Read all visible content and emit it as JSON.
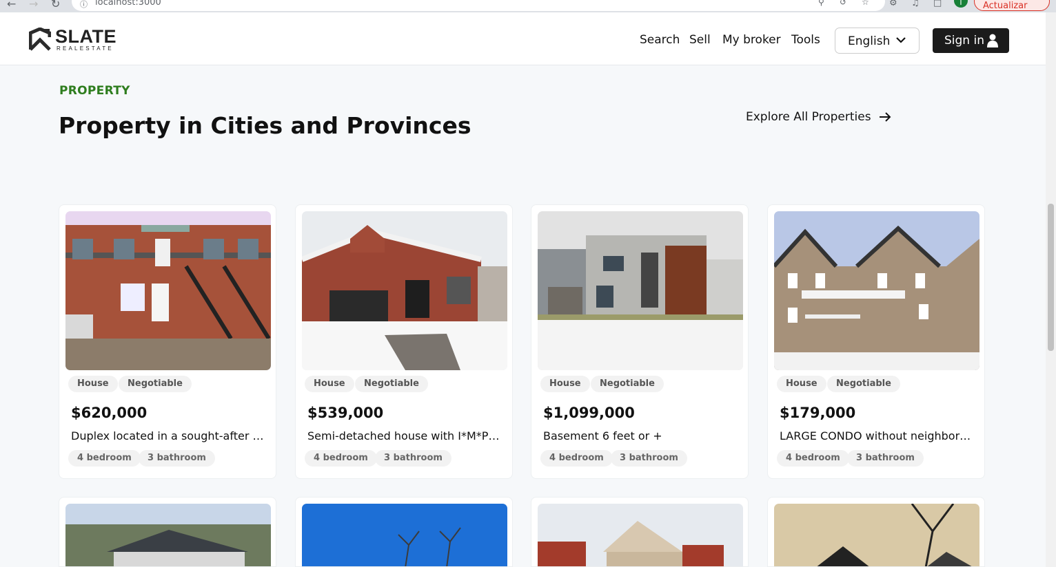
{
  "browser": {
    "url": "localhost:3000",
    "update_label": "Actualizar",
    "profile_initial": "T"
  },
  "header": {
    "logo_name": "SLATE",
    "logo_sub": "REALESTATE",
    "nav": [
      "Search",
      "Sell",
      "My broker",
      "Tools"
    ],
    "language": "English",
    "signin": "Sign in"
  },
  "section": {
    "eyebrow": "PROPERTY",
    "title": "Property in Cities and Provinces",
    "explore": "Explore All Properties"
  },
  "listings": [
    {
      "type": "House",
      "status": "Negotiable",
      "price": "$620,000",
      "description": "Duplex located in a sought-after neighbourhood",
      "bedrooms": "4 bedroom",
      "bathrooms": "3 bathroom"
    },
    {
      "type": "House",
      "status": "Negotiable",
      "price": "$539,000",
      "description": "Semi-detached house with I*M*P*E*C*C*A*B*L*E",
      "bedrooms": "4 bedroom",
      "bathrooms": "3 bathroom"
    },
    {
      "type": "House",
      "status": "Negotiable",
      "price": "$1,099,000",
      "description": "Basement 6 feet or +",
      "bedrooms": "4 bedroom",
      "bathrooms": "3 bathroom"
    },
    {
      "type": "House",
      "status": "Negotiable",
      "price": "$179,000",
      "description": "LARGE CONDO without neighbors above",
      "bedrooms": "4 bedroom",
      "bathrooms": "3 bathroom"
    }
  ]
}
